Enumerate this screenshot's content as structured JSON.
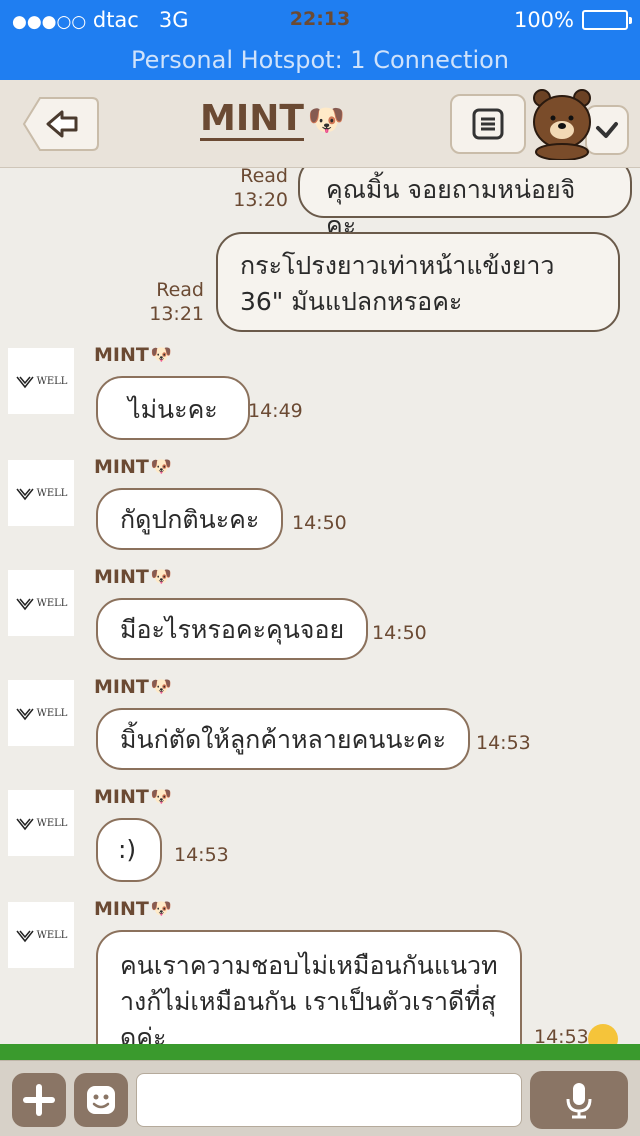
{
  "status_bar": {
    "signal": "●●●○○",
    "carrier": "dtac",
    "network": "3G",
    "time": "22:13",
    "battery": "100%",
    "battery_level": 1.0
  },
  "hotspot_banner": "Personal Hotspot: 1 Connection",
  "header": {
    "title": "MINT",
    "title_emoji": "🐶",
    "back_icon": "back-arrow-icon",
    "menu_icon": "list-icon",
    "sticker_icon": "brown-bear-icon"
  },
  "messages_out": [
    {
      "text": "คุณมิ้น จอยถามหน่อยจิคะ",
      "read": "Read",
      "time": "13:20"
    },
    {
      "text": "กระโปรงยาวเท่าหน้าแข้งยาว 36\" มันแปลกหรอคะ",
      "read": "Read",
      "time": "13:21"
    }
  ],
  "contact": {
    "name": "MINT",
    "name_emoji": "🐶",
    "avatar_text": "WELL"
  },
  "messages_in": [
    {
      "text": "ไม่นะคะ",
      "time": "14:49"
    },
    {
      "text": "กัดูปกตินะคะ",
      "time": "14:50"
    },
    {
      "text": "มีอะไรหรอคะคุนจอย",
      "time": "14:50"
    },
    {
      "text": "มิ้นก่ตัดให้ลูกค้าหลายคนนะคะ",
      "time": "14:53"
    },
    {
      "text": ":)",
      "time": "14:53"
    },
    {
      "text": "คนเราความชอบไม่เหมือนกันแนวทางก้ไม่เหมือนกัน เราเป็นตัวเราดีที่สุดค่ะ",
      "time": "14:53"
    }
  ],
  "input_bar": {
    "plus_icon": "plus-icon",
    "emoji_icon": "smiley-icon",
    "placeholder": "",
    "mic_icon": "microphone-icon"
  }
}
